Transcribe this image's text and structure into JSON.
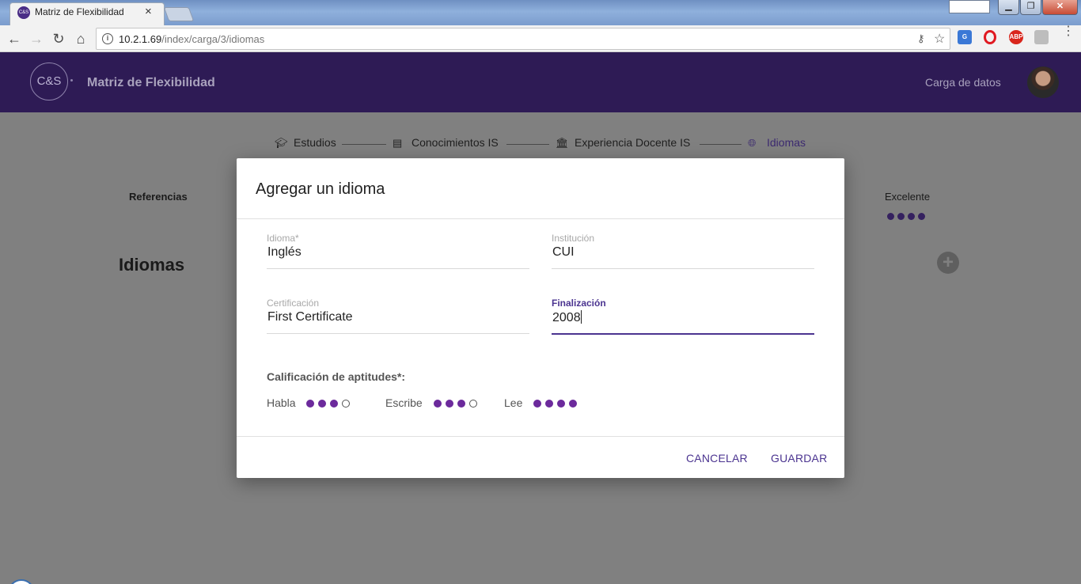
{
  "browser": {
    "tab_title": "Matriz de Flexibilidad",
    "tab_favicon_text": "C&S",
    "url_host": "10.2.1.69",
    "url_path": "/index/carga/3/idiomas"
  },
  "app": {
    "logo_text": "C&S",
    "title": "Matriz de Flexibilidad",
    "nav_link": "Carga de datos",
    "accent_color": "#4b3490",
    "header_color": "#2e1b55"
  },
  "stepper": {
    "steps": [
      {
        "label": "Estudios",
        "icon": "graduation-cap-icon"
      },
      {
        "label": "Conocimientos IS",
        "icon": "message-icon"
      },
      {
        "label": "Experiencia Docente IS",
        "icon": "bank-icon"
      },
      {
        "label": "Idiomas",
        "icon": "globe-icon"
      }
    ]
  },
  "background": {
    "references_label": "Referencias",
    "excellent_label": "Excelente",
    "section_title": "Idiomas"
  },
  "dialog": {
    "title": "Agregar un idioma",
    "fields": {
      "idioma": {
        "label": "Idioma*",
        "value": "Inglés"
      },
      "institucion": {
        "label": "Institución",
        "value": "CUI"
      },
      "certificacion": {
        "label": "Certificación",
        "value": "First Certificate"
      },
      "finalizacion": {
        "label": "Finalización",
        "value": "2008"
      }
    },
    "skills_title": "Calificación de aptitudes*:",
    "skills": [
      {
        "label": "Habla",
        "rating": 3,
        "max": 4
      },
      {
        "label": "Escribe",
        "rating": 3,
        "max": 4
      },
      {
        "label": "Lee",
        "rating": 4,
        "max": 4
      }
    ],
    "cancel_label": "CANCELAR",
    "save_label": "GUARDAR"
  }
}
